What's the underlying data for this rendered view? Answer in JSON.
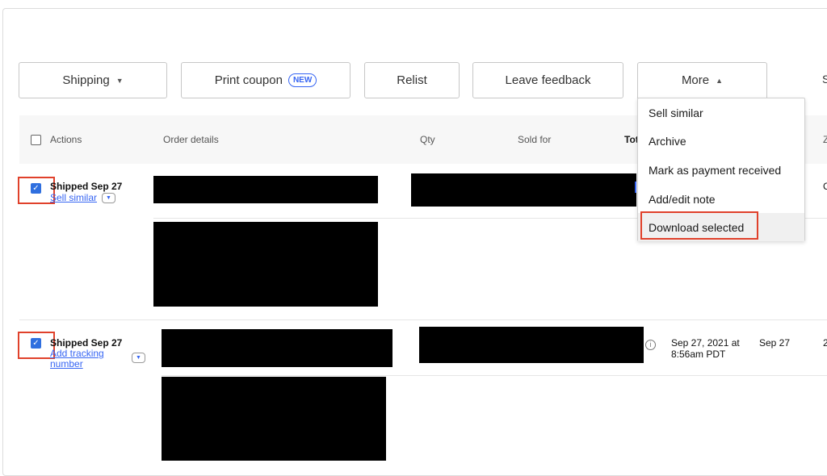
{
  "toolbar": {
    "shipping": "Shipping",
    "print_coupon": "Print coupon",
    "new_badge": "NEW",
    "relist": "Relist",
    "leave_feedback": "Leave feedback",
    "more": "More",
    "cut_next": "S"
  },
  "more_menu": {
    "items": [
      "Sell similar",
      "Archive",
      "Mark as payment received",
      "Add/edit note",
      "Download selected"
    ],
    "highlighted": "Download selected"
  },
  "table": {
    "headers": {
      "actions": "Actions",
      "order_details": "Order details",
      "qty": "Qty",
      "sold_for": "Sold for",
      "total_partial": "Tot",
      "cut_col": "Z"
    },
    "rows": [
      {
        "status": "Shipped Sep 27",
        "action_link": "Sell similar",
        "cut_text": "C"
      },
      {
        "status": "Shipped Sep 27",
        "action_link_line1": "Add tracking",
        "action_link_line2": "number",
        "paid_date_line1": "Sep 27, 2021 at",
        "paid_date_line2": "8:56am PDT",
        "shipped_date": "Sep 27",
        "cut_text": "2"
      }
    ]
  },
  "colors": {
    "accent_blue": "#3665f3",
    "highlight_red": "#e0412b",
    "checkbox_blue": "#2f6fdf"
  },
  "icons": {
    "caret_down": "caret-down-icon",
    "caret_up": "caret-up-icon",
    "info": "info-icon",
    "checkmark": "check-icon"
  }
}
